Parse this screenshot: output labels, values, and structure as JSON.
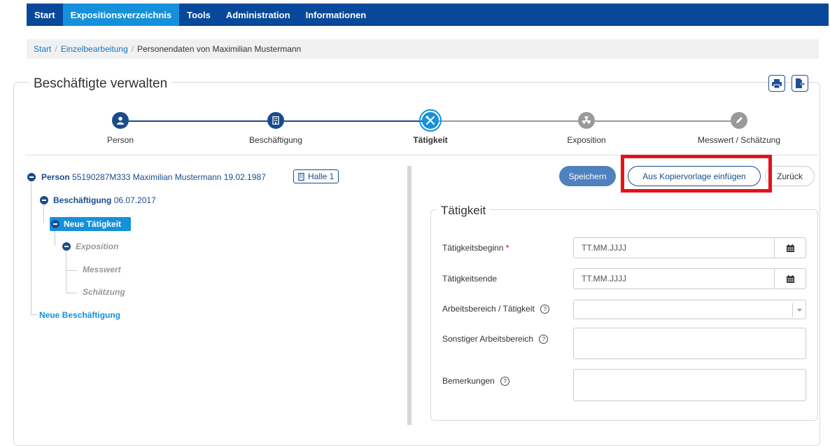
{
  "nav": {
    "items": [
      {
        "label": "Start"
      },
      {
        "label": "Expositionsverzeichnis"
      },
      {
        "label": "Tools"
      },
      {
        "label": "Administration"
      },
      {
        "label": "Informationen"
      }
    ]
  },
  "breadcrumb": {
    "items": [
      "Start",
      "Einzelbearbeitung"
    ],
    "current": "Personendaten von Maximilian Mustermann"
  },
  "panel": {
    "title": "Beschäftigte verwalten",
    "print_icon": "print-icon",
    "export_icon": "export-icon"
  },
  "stepper": {
    "steps": [
      {
        "label": "Person",
        "icon": "user-icon",
        "state": "done"
      },
      {
        "label": "Beschäftigung",
        "icon": "building-icon",
        "state": "done"
      },
      {
        "label": "Tätigkeit",
        "icon": "tools-icon",
        "state": "active"
      },
      {
        "label": "Exposition",
        "icon": "radiation-icon",
        "state": "pending"
      },
      {
        "label": "Messwert / Schätzung",
        "icon": "pencil-icon",
        "state": "pending"
      }
    ],
    "colors": {
      "done": "#1a4c8b",
      "active": "#1690db",
      "pending": "#999999"
    }
  },
  "tree": {
    "person_label": "Person",
    "person_detail": "55190287M333 Maximilian Mustermann 19.02.1987",
    "halle_badge": "Halle 1",
    "beschaeftigung_label": "Beschäftigung",
    "beschaeftigung_date": "06.07.2017",
    "taetigkeit_label": "Neue Tätigkeit",
    "exposition_label": "Exposition",
    "messwert_label": "Messwert",
    "schaetzung_label": "Schätzung",
    "neue_beschaeftigung_label": "Neue Beschäftigung"
  },
  "actions": {
    "save_label": "Speichern",
    "copy_template_label": "Aus Kopiervorlage einfügen",
    "back_label": "Zurück"
  },
  "form": {
    "title": "Tätigkeit",
    "fields": {
      "start": {
        "label": "Tätigkeitsbeginn",
        "required_mark": "*",
        "placeholder": "TT.MM.JJJJ"
      },
      "end": {
        "label": "Tätigkeitsende",
        "placeholder": "TT.MM.JJJJ"
      },
      "area": {
        "label": "Arbeitsbereich / Tätigkeit",
        "value": ""
      },
      "other_area": {
        "label": "Sonstiger Arbeitsbereich",
        "value": ""
      },
      "remarks": {
        "label": "Bemerkungen",
        "value": ""
      }
    }
  },
  "colors": {
    "nav_bg": "#07489a",
    "nav_active": "#1690db",
    "highlight": "#e8101b",
    "tree_selected": "#1690db"
  }
}
